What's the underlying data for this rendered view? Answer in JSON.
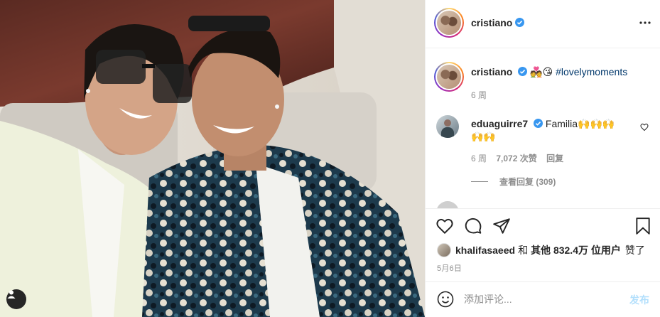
{
  "post": {
    "photo_alt": "",
    "user_tag_icon": "user-tag-icon"
  },
  "header": {
    "username": "cristiano",
    "verified_icon": "verified-badge-icon",
    "more_icon": "more-horizontal-icon"
  },
  "caption": {
    "username": "cristiano",
    "emojis": "💑😘",
    "hashtag": "#lovelymoments",
    "time": "6 周"
  },
  "comments": [
    {
      "username": "eduaguirre7",
      "text_line1": "Familia🙌🙌🙌",
      "text_line2": "🙌🙌",
      "time": "6 周",
      "likes": "7,072 次赞",
      "reply": "回复",
      "view_replies": "查看回复 (309)"
    }
  ],
  "actions": {
    "like_icon": "heart-icon",
    "comment_icon": "comment-icon",
    "share_icon": "paper-plane-icon",
    "save_icon": "bookmark-icon"
  },
  "likes": {
    "first_user": "khalifasaeed",
    "connector": "和",
    "others_label": "其他 832.4万 位用户",
    "suffix": "赞了"
  },
  "date": "5月6日",
  "comment_box": {
    "emoji_icon": "smiley-icon",
    "placeholder": "添加评论...",
    "post_label": "发布"
  },
  "colors": {
    "verified": "#3897f0",
    "hashtag": "#00376b",
    "post_disabled": "#b2dffc"
  }
}
